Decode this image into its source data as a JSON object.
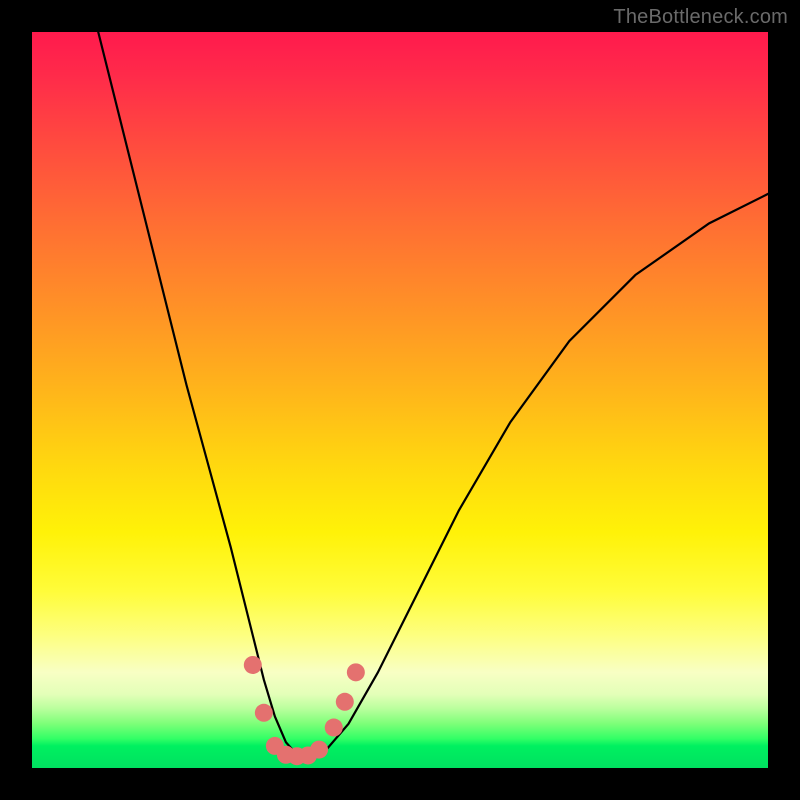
{
  "watermark": "TheBottleneck.com",
  "colors": {
    "frame": "#000000",
    "curve": "#000000",
    "markers": "#e4716f",
    "gradient_top": "#ff1a4d",
    "gradient_bottom": "#00e060"
  },
  "chart_data": {
    "type": "line",
    "title": "",
    "xlabel": "",
    "ylabel": "",
    "xlim": [
      0,
      100
    ],
    "ylim": [
      0,
      100
    ],
    "grid": false,
    "legend": false,
    "background": "vertical-gradient red→yellow→green",
    "note": "No axis ticks or numeric labels are rendered in the image; x is a normalized horizontal position (0–100 left→right) and y is a normalized vertical value (0 at bottom, 100 at top). Curve values are estimated from pixel positions.",
    "series": [
      {
        "name": "bottleneck-curve",
        "color": "#000000",
        "x": [
          9,
          12,
          15,
          18,
          21,
          24,
          27,
          30,
          31.5,
          33,
          34.5,
          36,
          37.5,
          40,
          43,
          47,
          52,
          58,
          65,
          73,
          82,
          92,
          100
        ],
        "y": [
          100,
          88,
          76,
          64,
          52,
          41,
          30,
          18,
          12,
          7,
          3.5,
          1.8,
          1.5,
          2.5,
          6,
          13,
          23,
          35,
          47,
          58,
          67,
          74,
          78
        ]
      }
    ],
    "markers": {
      "name": "highlighted-range",
      "color": "#e4716f",
      "shape": "circle",
      "radius_px": 9,
      "points": [
        {
          "x": 30.0,
          "y": 14.0
        },
        {
          "x": 31.5,
          "y": 7.5
        },
        {
          "x": 33.0,
          "y": 3.0
        },
        {
          "x": 34.5,
          "y": 1.8
        },
        {
          "x": 36.0,
          "y": 1.6
        },
        {
          "x": 37.5,
          "y": 1.7
        },
        {
          "x": 39.0,
          "y": 2.5
        },
        {
          "x": 41.0,
          "y": 5.5
        },
        {
          "x": 42.5,
          "y": 9.0
        },
        {
          "x": 44.0,
          "y": 13.0
        }
      ]
    }
  }
}
